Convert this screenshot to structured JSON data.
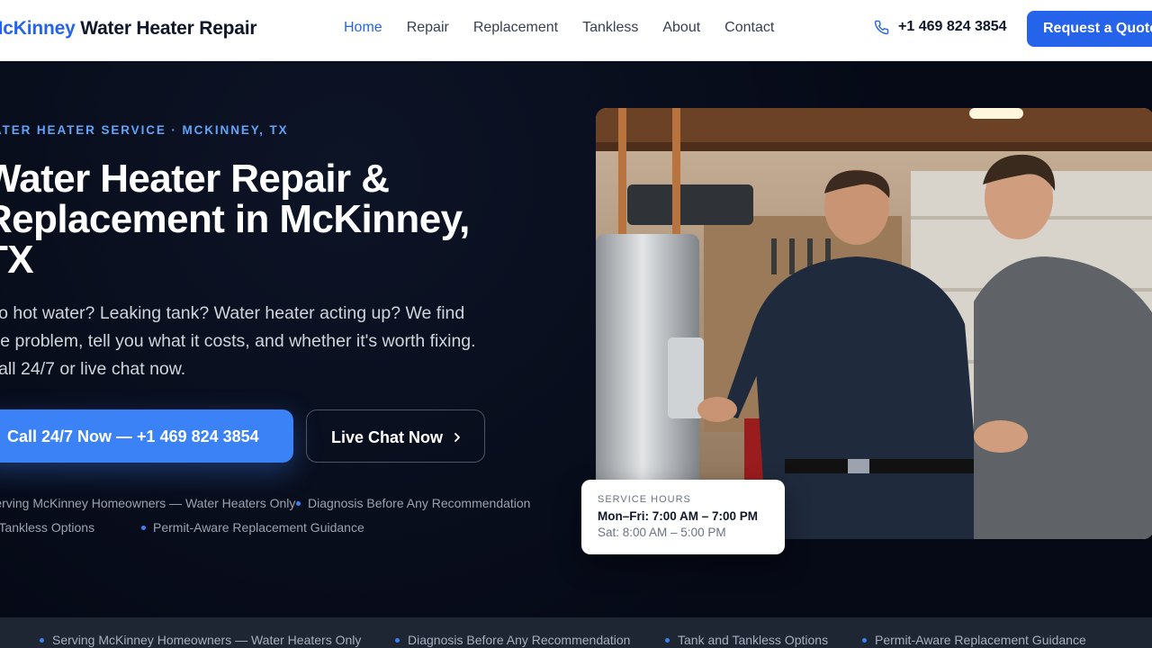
{
  "header": {
    "brand_accent": "McKinney",
    "brand_rest": " Water Heater Repair",
    "nav": [
      {
        "label": "Home",
        "active": true
      },
      {
        "label": "Repair",
        "active": false
      },
      {
        "label": "Replacement",
        "active": false
      },
      {
        "label": "Tankless",
        "active": false
      },
      {
        "label": "About",
        "active": false
      },
      {
        "label": "Contact",
        "active": false
      }
    ],
    "phone": "+1 469 824 3854",
    "phone_icon": "phone-icon",
    "cta": "Request a Quote"
  },
  "hero": {
    "eyebrow": "WATER HEATER SERVICE · MCKINNEY, TX",
    "headline": "Water Heater Repair & Replacement in McKinney, TX",
    "subtext": "No hot water? Leaking tank? Water heater acting up? We find the problem, tell you what it costs, and whether it's worth fixing. Call 24/7 or live chat now.",
    "call_button": "Call 24/7 Now — +1 469 824 3854",
    "chat_button": "Live Chat Now",
    "chat_icon": "chevron-right-icon",
    "features": [
      "Serving McKinney Homeowners — Water Heaters Only",
      "Diagnosis Before Any Recommendation",
      "Tank and Tankless Options",
      "Permit-Aware Replacement Guidance"
    ]
  },
  "hours_card": {
    "label": "SERVICE HOURS",
    "weekday": "Mon–Fri: 7:00 AM – 7:00 PM",
    "saturday": "Sat: 8:00 AM – 5:00 PM"
  },
  "trust_bar": [
    "Serving McKinney Homeowners — Water Heaters Only",
    "Diagnosis Before Any Recommendation",
    "Tank and Tankless Options",
    "Permit-Aware Replacement Guidance"
  ],
  "colors": {
    "accent": "#2563eb",
    "hero_bg": "#060a17",
    "eyebrow": "#60a5fa",
    "call_button": "#3b82f6",
    "trust_bar_bg": "#1e2533"
  }
}
